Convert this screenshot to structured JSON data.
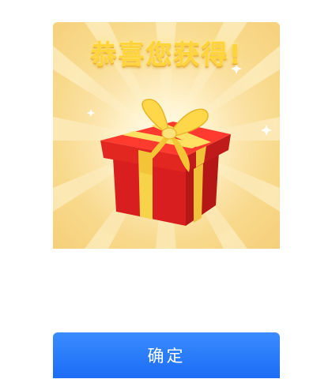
{
  "reward": {
    "title": "恭喜您获得!",
    "title_color": "#ffd43b",
    "background_color": "#f8d98b",
    "gift_box_color": "#d81e1e",
    "ribbon_color": "#f7d34a"
  },
  "footer": {
    "confirm_label": "确定",
    "button_color": "#1c6cf5"
  }
}
